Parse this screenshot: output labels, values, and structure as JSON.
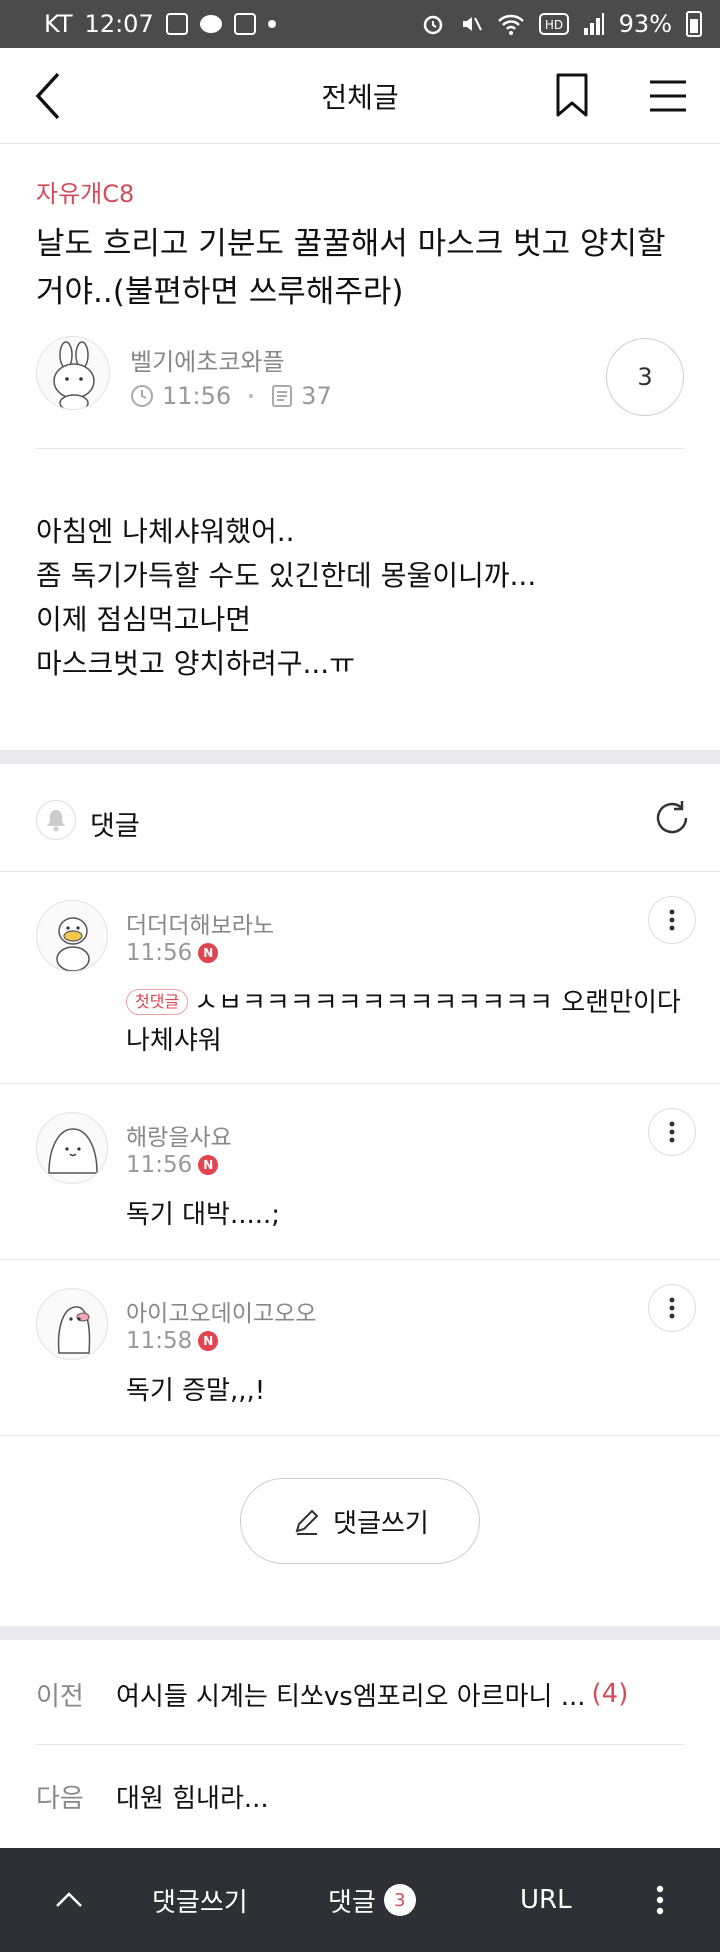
{
  "status_bar": {
    "carrier": "KT",
    "time": "12:07",
    "battery": "93%"
  },
  "header": {
    "title": "전체글"
  },
  "post": {
    "category": "자유개C8",
    "title": "날도 흐리고 기분도 꿀꿀해서 마스크 벗고 양치할거야..(불편하면 쓰루해주라)",
    "author": "벨기에초코와플",
    "time": "11:56",
    "views": "37",
    "comment_count": "3",
    "body": [
      "아침엔 나체샤워했어..",
      "좀 독기가득할 수도 있긴한데 몽울이니까...",
      "이제 점심먹고나면",
      "마스크벗고 양치하려구...ㅠ"
    ]
  },
  "comments_section": {
    "label": "댓글",
    "items": [
      {
        "name": "더더더해보라노",
        "time": "11:56",
        "badge": "N",
        "first_badge": "첫댓글",
        "text": "ㅅㅂㅋㅋㅋㅋㅋㅋㅋㅋㅋㅋㅋㅋㅋ 오랜만이다 나체샤워"
      },
      {
        "name": "해랑을사요",
        "time": "11:56",
        "badge": "N",
        "text": "독기 대박.....;"
      },
      {
        "name": "아이고오데이고오오",
        "time": "11:58",
        "badge": "N",
        "text": "독기 증말,,,!"
      }
    ],
    "write_button": "댓글쓰기"
  },
  "navigation": {
    "prev_label": "이전",
    "prev_title": "여시들 시계는 티쏘vs엠포리오 아르마니 ...",
    "prev_count": "(4)",
    "next_label": "다음",
    "next_title": "대원 힘내라..."
  },
  "bottom_bar": {
    "write": "댓글쓰기",
    "comments": "댓글",
    "comments_count": "3",
    "url": "URL"
  },
  "colors": {
    "accent": "#d24c5a",
    "badge_red": "#e0444f",
    "bottom_bar": "#2f3035",
    "status_bar": "#4b4b4b"
  }
}
